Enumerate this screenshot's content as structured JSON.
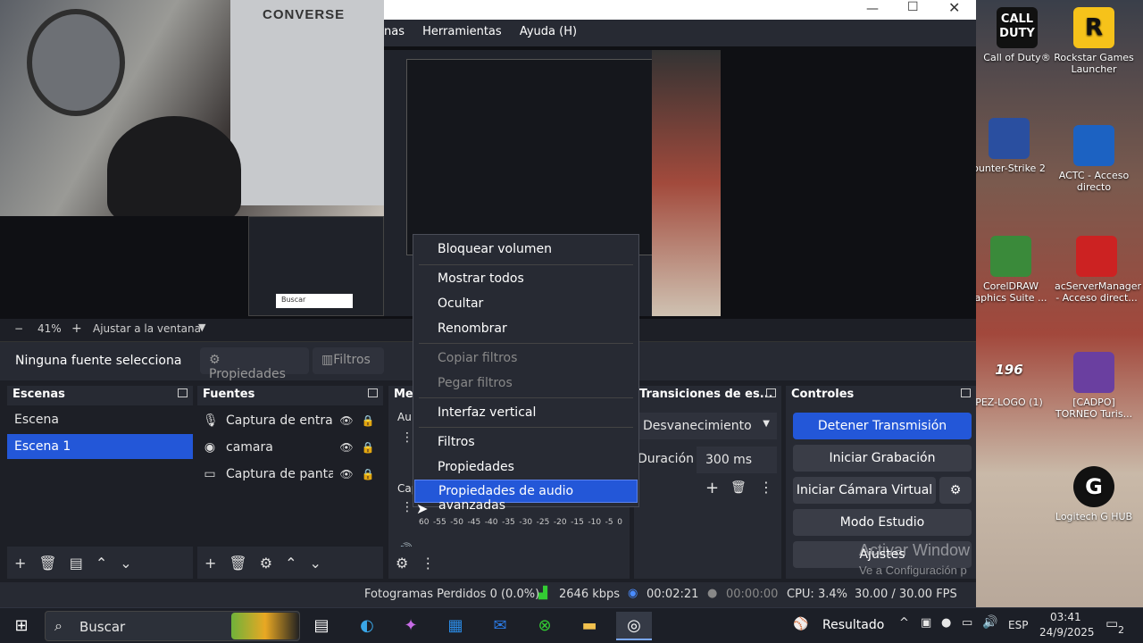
{
  "desktop_icons": [
    {
      "label": "Call of Duty®",
      "color": "#111"
    },
    {
      "label": "Rockstar Games Launcher",
      "color": "#f6c21a"
    },
    {
      "label": "ounter-Strike 2",
      "color": "#2a4fa0"
    },
    {
      "label": "ACTC - Acceso directo",
      "color": "#1c62c2"
    },
    {
      "label": "CorelDRAW aphics Suite ...",
      "color": "#3a8a3a"
    },
    {
      "label": "acServerManager - Acceso direct...",
      "color": "#c22"
    },
    {
      "label": "PEZ-LOGO (1)",
      "color": "#333"
    },
    {
      "label": "[CADPO] TORNEO Turis...",
      "color": "#6a3fa0"
    },
    {
      "label": "Logitech G HUB",
      "color": "#111"
    }
  ],
  "webcam": {
    "shirt_text": "CONVERSE"
  },
  "menubar": {
    "items": [
      "nas",
      "Herramientas",
      "Ayuda (H)"
    ]
  },
  "zoom": {
    "minus": "−",
    "level": "41%",
    "plus": "+",
    "fit": "Ajustar a la ventana"
  },
  "source_bar": {
    "no_source": "Ninguna fuente selecciona",
    "properties": "Propiedades",
    "filters": "Filtros"
  },
  "scenes": {
    "title": "Escenas",
    "items": [
      "Escena",
      "Escena 1"
    ]
  },
  "sources": {
    "title": "Fuentes",
    "items": [
      {
        "label": "Captura de entrada",
        "icon": "mic"
      },
      {
        "label": "camara",
        "icon": "camera"
      },
      {
        "label": "Captura de pantalla",
        "icon": "monitor"
      }
    ]
  },
  "mixer": {
    "title": "Me",
    "audio_label": "Au",
    "cap_label": "Cap",
    "meter_ticks": [
      "60",
      "-55",
      "-50",
      "-45",
      "-40",
      "-35",
      "-30",
      "-25",
      "-20",
      "-15",
      "-10",
      "-5",
      "0"
    ]
  },
  "transitions": {
    "title": "Transiciones de es...",
    "type": "Desvanecimiento",
    "duration_label": "Duración",
    "duration": "300 ms"
  },
  "controls": {
    "title": "Controles",
    "buttons": [
      "Detener Transmisión",
      "Iniciar Grabación",
      "Iniciar Cámara Virtual",
      "Modo Estudio",
      "Ajustes"
    ]
  },
  "context_menu": {
    "items": [
      {
        "label": "Bloquear volumen",
        "disabled": false
      },
      {
        "label": "Mostrar todos",
        "disabled": false
      },
      {
        "label": "Ocultar",
        "disabled": false
      },
      {
        "label": "Renombrar",
        "disabled": false
      },
      {
        "label": "Copiar filtros",
        "disabled": true
      },
      {
        "label": "Pegar filtros",
        "disabled": true
      },
      {
        "label": "Interfaz vertical",
        "disabled": false
      },
      {
        "label": "Filtros",
        "disabled": false
      },
      {
        "label": "Propiedades",
        "disabled": false
      },
      {
        "label": "Propiedades de audio avanzadas",
        "disabled": false
      }
    ]
  },
  "status": {
    "dropped": "Fotogramas Perdidos 0 (0.0%)",
    "bitrate": "2646 kbps",
    "live_time": "00:02:21",
    "rec_time": "00:00:00",
    "cpu": "CPU: 3.4%",
    "fps": "30.00 / 30.00 FPS"
  },
  "watermark": {
    "line1": "Activar Window",
    "line2": "Ve a Configuración p"
  },
  "taskbar": {
    "search_placeholder": "Buscar",
    "weather": "Resultado",
    "lang": "ESP",
    "time": "03:41",
    "date": "24/9/2025",
    "notif": "2"
  },
  "preview_small": {
    "search": "Buscar"
  },
  "colors": {
    "accent": "#2357d8",
    "panel": "#272a33",
    "bg": "#1d1f26"
  }
}
